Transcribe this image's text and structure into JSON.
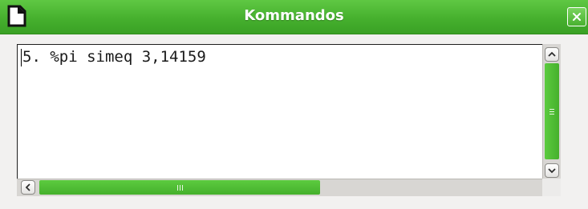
{
  "window": {
    "title": "Kommandos",
    "accent_color": "#46b02e",
    "icons": {
      "app": "document-icon",
      "close": "close-icon"
    }
  },
  "editor": {
    "text": "5. %pi simeq 3,14159"
  },
  "scrollbars": {
    "vertical": {
      "up_icon": "chevron-up-icon",
      "down_icon": "chevron-down-icon",
      "thumb_fraction": 1.0
    },
    "horizontal": {
      "left_icon": "chevron-left-icon",
      "right_icon": "chevron-right-icon",
      "thumb_fraction": 0.55
    }
  }
}
